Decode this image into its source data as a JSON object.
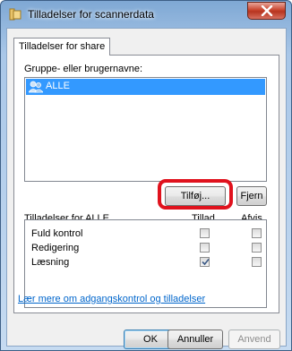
{
  "window": {
    "title": "Tilladelser for scannerdata"
  },
  "tabs": [
    {
      "label": "Tilladelser for share"
    }
  ],
  "groups": {
    "label": "Gruppe- eller brugernavne:",
    "items": [
      {
        "label": "ALLE",
        "selected": true
      }
    ],
    "add_label": "Tilføj...",
    "remove_label": "Fjern"
  },
  "permissions": {
    "header": "Tilladelser for ALLE",
    "allow_header": "Tillad",
    "deny_header": "Afvis",
    "rows": [
      {
        "name": "Fuld kontrol",
        "allow": false,
        "deny": false
      },
      {
        "name": "Redigering",
        "allow": false,
        "deny": false
      },
      {
        "name": "Læsning",
        "allow": true,
        "deny": false
      }
    ]
  },
  "link": "Lær mere om adgangskontrol og tilladelser",
  "footer": {
    "ok_label": "OK",
    "cancel_label": "Annuller",
    "apply_label": "Anvend"
  },
  "colors": {
    "selection": "#3399ff",
    "highlight": "#e0121d",
    "link": "#0066cc"
  }
}
